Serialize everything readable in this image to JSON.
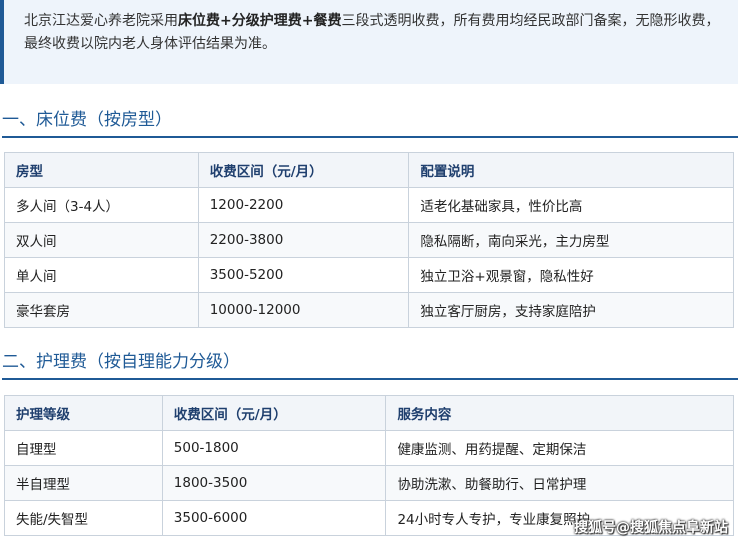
{
  "intro": {
    "pre": "北京江达爱心养老院采用",
    "bold1": "床位费+分级护理费+餐费",
    "post": "三段式透明收费，所有费用均经民政部门备案，无隐形收费，最终收费以院内老人身体评估结果为准。"
  },
  "section1": {
    "title": "一、床位费（按房型）",
    "headers": [
      "房型",
      "收费区间（元/月）",
      "配置说明"
    ],
    "rows": [
      [
        "多人间（3-4人）",
        "1200-2200",
        "适老化基础家具，性价比高"
      ],
      [
        "双人间",
        "2200-3800",
        "隐私隔断，南向采光，主力房型"
      ],
      [
        "单人间",
        "3500-5200",
        "独立卫浴+观景窗，隐私性好"
      ],
      [
        "豪华套房",
        "10000-12000",
        "独立客厅厨房，支持家庭陪护"
      ]
    ]
  },
  "section2": {
    "title": "二、护理费（按自理能力分级）",
    "headers": [
      "护理等级",
      "收费区间（元/月）",
      "服务内容"
    ],
    "rows": [
      [
        "自理型",
        "500-1800",
        "健康监测、用药提醒、定期保洁"
      ],
      [
        "半自理型",
        "1800-3500",
        "协助洗漱、助餐助行、日常护理"
      ],
      [
        "失能/失智型",
        "3500-6000",
        "24小时专人专护，专业康复照护"
      ]
    ]
  },
  "watermark": "搜狐号@搜狐焦点阜新站",
  "colors": {
    "accent": "#1f5a96",
    "intro_bg": "#eef4fb",
    "header_bg": "#f2f5f9",
    "border": "#c9d2dc"
  }
}
